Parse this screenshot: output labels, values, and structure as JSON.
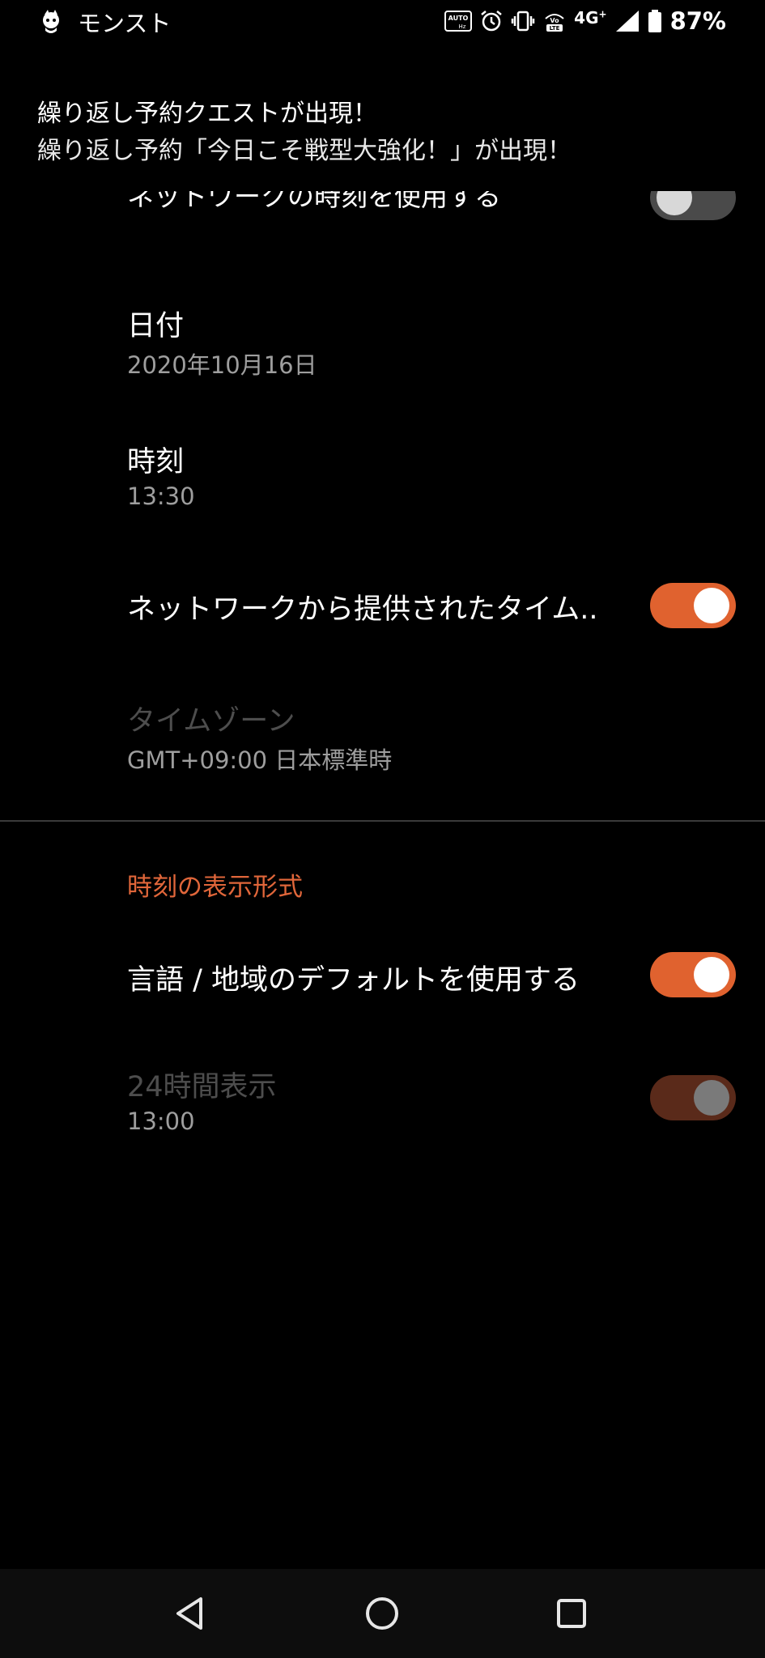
{
  "status_bar": {
    "app_name": "モンスト",
    "network": "4G",
    "battery": "87%"
  },
  "notification": {
    "title": "繰り返し予約クエストが出現！",
    "text": "繰り返し予約「今日こそ戦型大強化！」が出現！"
  },
  "settings": {
    "clipped_item": {
      "title": "ネットワークの時刻を使用する",
      "toggle": false
    },
    "date": {
      "title": "日付",
      "value": "2020年10月16日"
    },
    "time": {
      "title": "時刻",
      "value": "13:30"
    },
    "network_timezone": {
      "title": "ネットワークから提供されたタイム..",
      "toggle": true
    },
    "timezone": {
      "title": "タイムゾーン",
      "value": "GMT+09:00 日本標準時",
      "enabled": false
    },
    "format_section": {
      "header": "時刻の表示形式"
    },
    "use_locale_default": {
      "title": "言語 / 地域のデフォルトを使用する",
      "toggle": true
    },
    "hour24": {
      "title": "24時間表示",
      "value": "13:00",
      "toggle": true,
      "enabled": false
    }
  },
  "nav_bar": {
    "back": "back-icon",
    "home": "home-icon",
    "recents": "recents-icon"
  },
  "colors": {
    "accent": "#e0622f",
    "background": "#000000"
  }
}
